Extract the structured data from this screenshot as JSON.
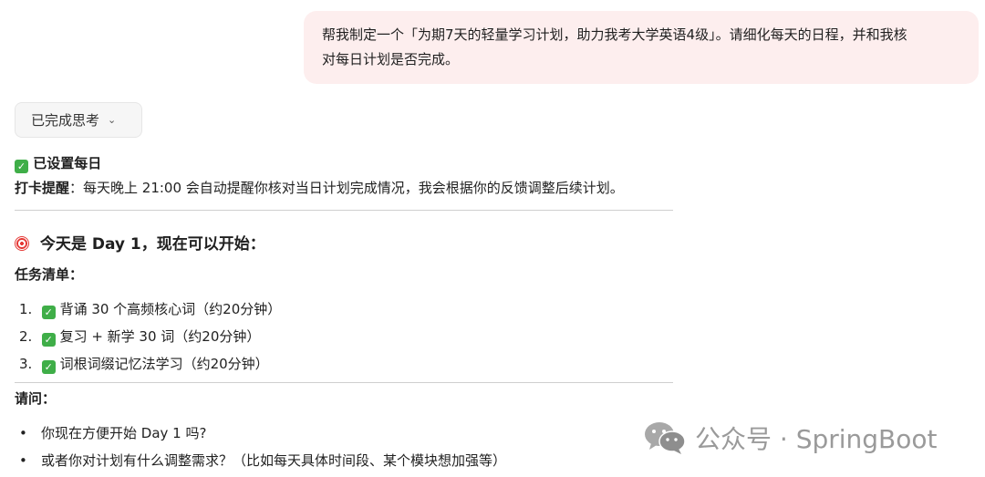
{
  "user_message": {
    "line1": "帮我制定一个「为期7天的轻量学习计划，助力我考大学英语4级」。请细化每天的日程，并和我核",
    "line2": "对每日计划是否完成。"
  },
  "thinking_button": {
    "label": "已完成思考"
  },
  "reply": {
    "reminder_title": "已设置每日",
    "reminder_bold": "打卡提醒",
    "reminder_text": "：每天晚上 21:00 会自动提醒你核对当日计划完成情况，我会根据你的反馈调整后续计划。",
    "today_heading": "今天是 Day 1，现在可以开始：",
    "task_list_label": "任务清单：",
    "tasks": [
      {
        "num": "1.",
        "text": "背诵 30 个高频核心词（约20分钟）"
      },
      {
        "num": "2.",
        "text": "复习 + 新学 30 词（约20分钟）"
      },
      {
        "num": "3.",
        "text": "词根词缀记忆法学习（约20分钟）"
      }
    ],
    "question_label": "请问：",
    "questions": [
      "你现在方便开始 Day 1 吗?",
      "或者你对计划有什么调整需求？（比如每天具体时间段、某个模块想加强等）"
    ]
  },
  "watermark": {
    "text": "公众号 · SpringBoot"
  },
  "icons": {
    "check": "check-mark-icon",
    "target": "dart-target-icon",
    "chevron": "chevron-down-icon",
    "wechat": "wechat-icon"
  },
  "colors": {
    "user_bubble": "#fdeeee",
    "check_green": "#3fae48",
    "target_red": "#e53935",
    "watermark": "#9a9a9a"
  }
}
